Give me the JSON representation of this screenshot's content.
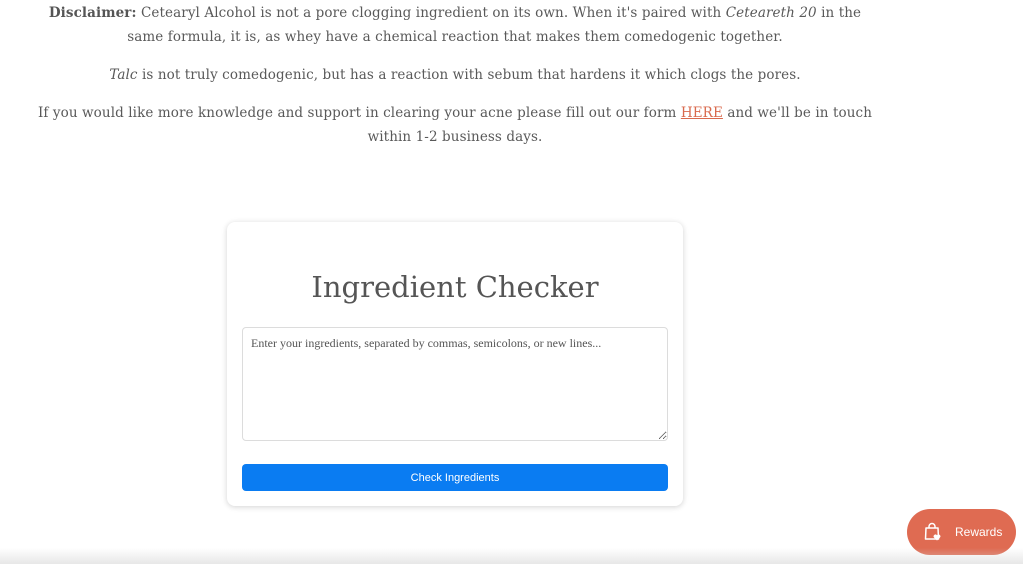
{
  "article": {
    "disclaimer_label": "Disclaimer:",
    "disclaimer_text_1": " Cetearyl Alcohol is not a pore clogging ingredient on its own. When it's paired with ",
    "disclaimer_em": "Ceteareth 20",
    "disclaimer_text_2": " in the same formula, it is, as whey have a chemical reaction that makes them comedogenic together.",
    "talc_em": "Talc",
    "talc_text": " is not truly comedogenic, but has a reaction with sebum that hardens it which clogs the pores.",
    "form_text_1": "If you would like more knowledge and support in clearing your acne please fill out our form ",
    "form_link": "HERE",
    "form_text_2": " and we'll be in touch within 1-2 business days."
  },
  "checker": {
    "title": "Ingredient Checker",
    "placeholder": "Enter your ingredients, separated by commas, semicolons, or new lines...",
    "value": "",
    "button_label": "Check Ingredients"
  },
  "rewards": {
    "label": "Rewards",
    "icon": "shopping-bag-heart-icon"
  },
  "colors": {
    "accent_link": "#d9694d",
    "button_blue": "#0a7cf2",
    "rewards_bg": "#df6b52"
  }
}
